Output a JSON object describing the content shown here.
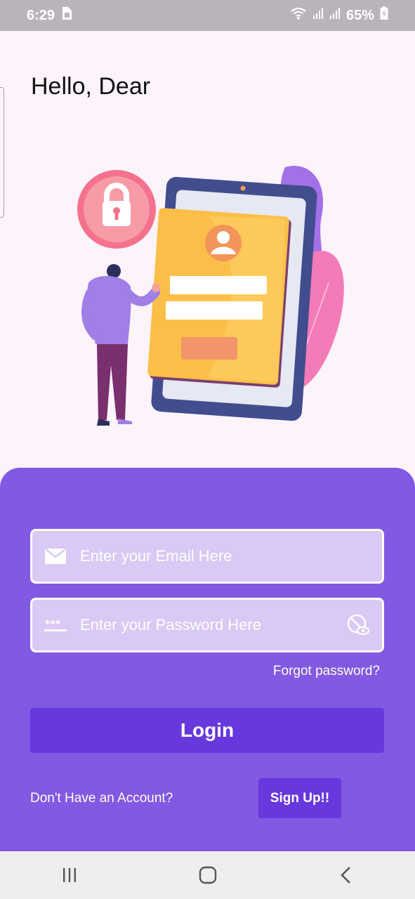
{
  "status_bar": {
    "time": "6:29",
    "battery": "65%",
    "icons": [
      "sim-card-icon",
      "wifi-icon",
      "signal-icon",
      "signal-icon",
      "battery-charging-icon"
    ]
  },
  "greeting": "Hello, Dear",
  "illustration": {
    "icon": "login-security-illustration"
  },
  "form": {
    "email": {
      "placeholder": "Enter your Email Here",
      "value": "",
      "icon": "mail-icon"
    },
    "password": {
      "placeholder": "Enter your Password Here",
      "value": "",
      "icon": "password-dots-icon",
      "toggle_icon": "visibility-toggle-icon"
    },
    "forgot_label": "Forgot password?",
    "login_label": "Login",
    "no_account_label": "Don't Have an Account?",
    "signup_label": "Sign Up!!"
  },
  "nav_bar": {
    "icons": [
      "recent-apps-icon",
      "home-icon",
      "back-icon"
    ]
  },
  "colors": {
    "background": "#fdf3fb",
    "panel": "#8259e2",
    "button": "#6738de",
    "field": "#d9c9f4",
    "status_bar": "#b9b4b9"
  }
}
